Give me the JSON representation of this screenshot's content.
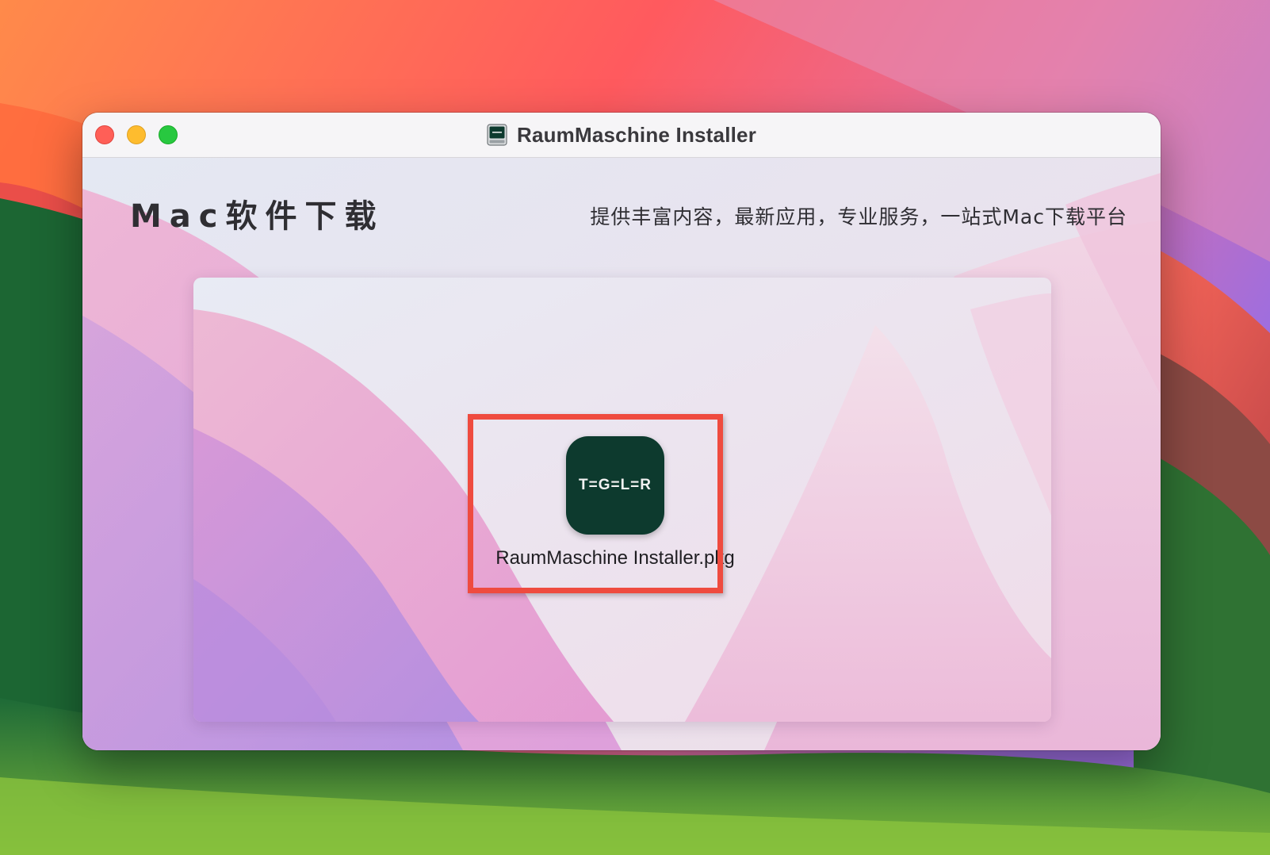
{
  "window": {
    "title": "RaumMaschine Installer",
    "title_icon": "disk-image-icon",
    "traffic_lights": {
      "close": "#ff5f57",
      "minimize": "#febc2e",
      "maximize": "#28c840"
    }
  },
  "header": {
    "brand": "Mac软件下载",
    "tagline": "提供丰富内容，最新应用，专业服务，一站式Mac下载平台"
  },
  "package": {
    "filename": "RaumMaschine Installer.pkg",
    "icon_text": "T=G=L=R",
    "icon_bg": "#0d3a2e"
  },
  "highlight": {
    "color": "#ef4b3f"
  }
}
